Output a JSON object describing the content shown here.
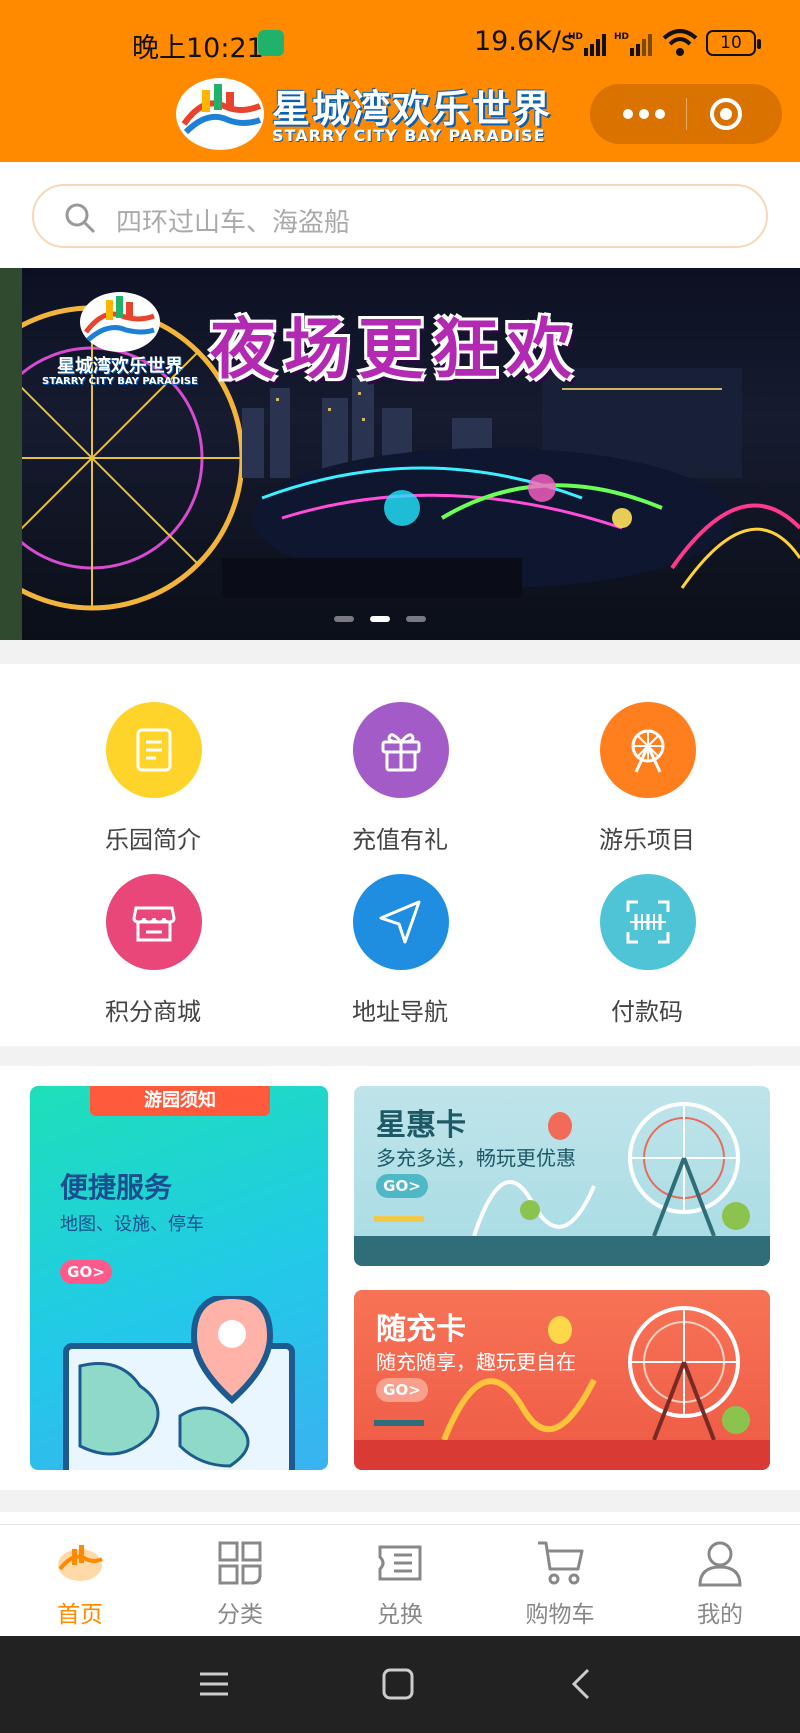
{
  "status_bar": {
    "time": "晚上10:21",
    "net_speed": "19.6K/s",
    "battery": "10"
  },
  "header": {
    "logo_cn": "星城湾欢乐世界",
    "logo_en": "STARRY CITY BAY PARADISE",
    "brand_color": "#ff8a00"
  },
  "search": {
    "placeholder": "四环过山车、海盗船"
  },
  "banner": {
    "title": "夜场更狂欢",
    "logo_cn": "星城湾欢乐世界",
    "logo_en": "STARRY CITY BAY PARADISE",
    "slide_count": 3,
    "active_slide": 2
  },
  "shortcuts": [
    {
      "label": "乐园简介",
      "icon": "document-icon",
      "color": "#ffd42a"
    },
    {
      "label": "充值有礼",
      "icon": "gift-icon",
      "color": "#a35bc8"
    },
    {
      "label": "游乐项目",
      "icon": "ferris-wheel-icon",
      "color": "#ff7f1f"
    },
    {
      "label": "积分商城",
      "icon": "store-icon",
      "color": "#e9467a"
    },
    {
      "label": "地址导航",
      "icon": "navigation-icon",
      "color": "#1f8ee0"
    },
    {
      "label": "付款码",
      "icon": "scan-code-icon",
      "color": "#4fc4d6"
    }
  ],
  "promos": {
    "guide": {
      "tag": "游园须知",
      "title": "便捷服务",
      "subtitle": "地图、设施、停车",
      "go": "GO>"
    },
    "star_card": {
      "title": "星惠卡",
      "subtitle": "多充多送，畅玩更优惠",
      "go": "GO>"
    },
    "topup_card": {
      "title": "随充卡",
      "subtitle": "随充随享，趣玩更自在",
      "go": "GO>"
    }
  },
  "tabbar": [
    {
      "label": "首页",
      "icon": "home-logo-icon",
      "active": true
    },
    {
      "label": "分类",
      "icon": "category-icon",
      "active": false
    },
    {
      "label": "兑换",
      "icon": "ticket-icon",
      "active": false
    },
    {
      "label": "购物车",
      "icon": "cart-icon",
      "active": false
    },
    {
      "label": "我的",
      "icon": "user-icon",
      "active": false
    }
  ]
}
